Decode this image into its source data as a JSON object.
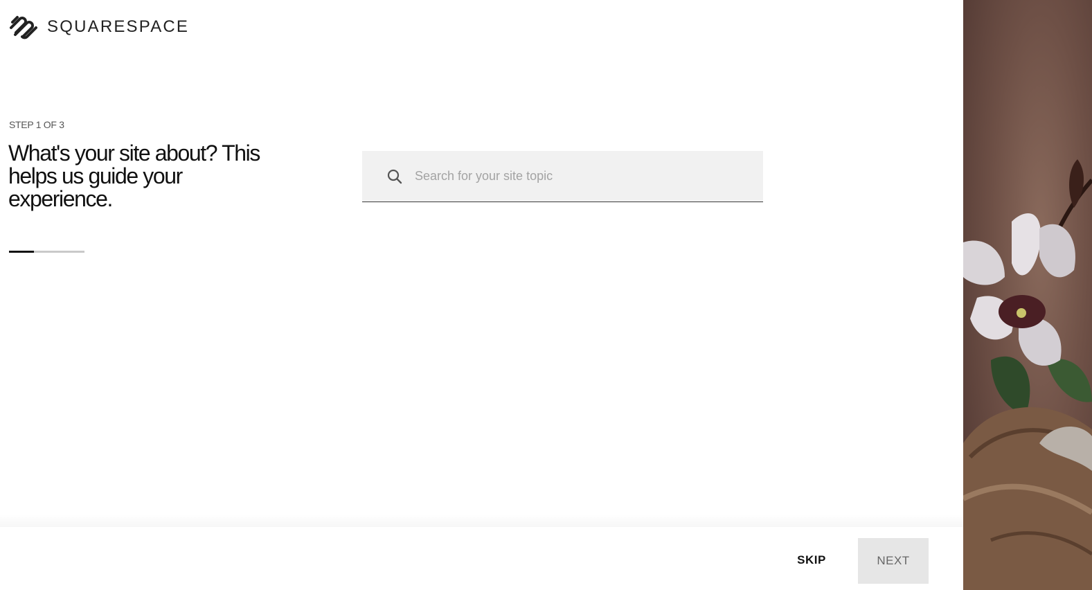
{
  "brand": {
    "name": "SQUARESPACE"
  },
  "onboarding": {
    "step_label": "STEP 1 OF 3",
    "heading": "What's your site about? This helps us guide your experience.",
    "progress": {
      "current_step": 1,
      "total_steps": 3,
      "fraction": 0.33
    }
  },
  "search": {
    "placeholder": "Search for your site topic",
    "value": "",
    "icon": "search-icon"
  },
  "footer": {
    "skip_label": "SKIP",
    "next_label": "NEXT"
  },
  "colors": {
    "text": "#111111",
    "search_bg": "#f1f1f1",
    "next_disabled_bg": "#e6e6e6",
    "hero_bg": "#6e5046"
  }
}
